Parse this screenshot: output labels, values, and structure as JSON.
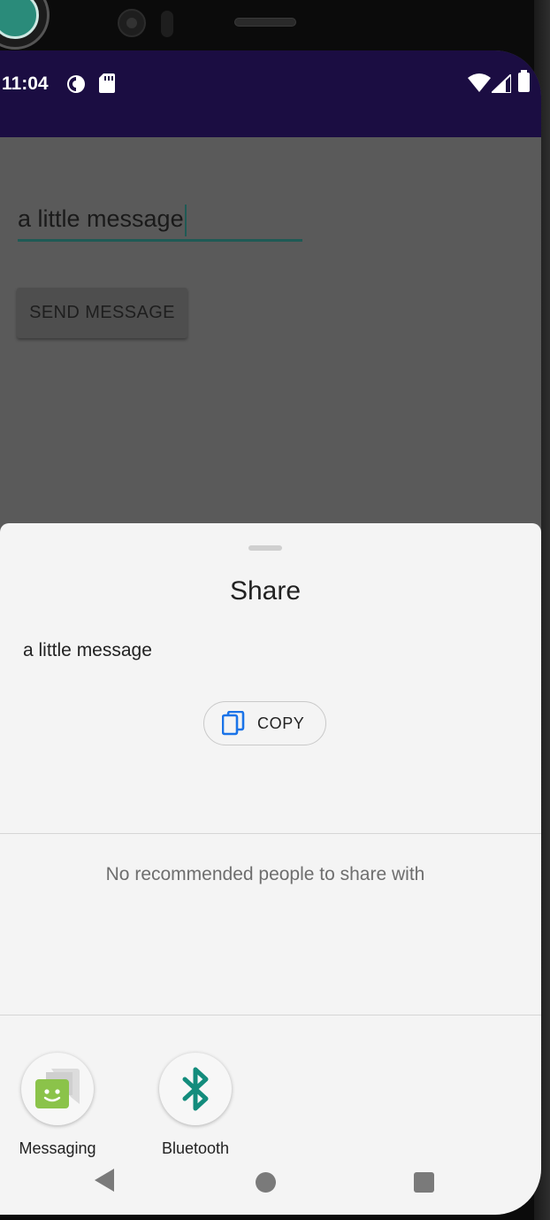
{
  "status_bar": {
    "time": "11:04",
    "background": "#1b0d42"
  },
  "app": {
    "message_input_value": "a little message",
    "send_button_label": "SEND MESSAGE"
  },
  "share_sheet": {
    "title": "Share",
    "shared_text": "a little message",
    "copy_label": "COPY",
    "no_recommendations_text": "No recommended people to share with",
    "targets": [
      {
        "label": "Messaging",
        "icon": "messaging-app-icon"
      },
      {
        "label": "Bluetooth",
        "icon": "bluetooth-icon"
      }
    ]
  },
  "navigation": {
    "icons": [
      "back-icon",
      "home-icon",
      "recents-icon"
    ]
  },
  "colors": {
    "accent": "#1f5a55",
    "copy_icon": "#1a73e8",
    "bluetooth": "#138c7c",
    "messaging": "#8bc34a"
  }
}
